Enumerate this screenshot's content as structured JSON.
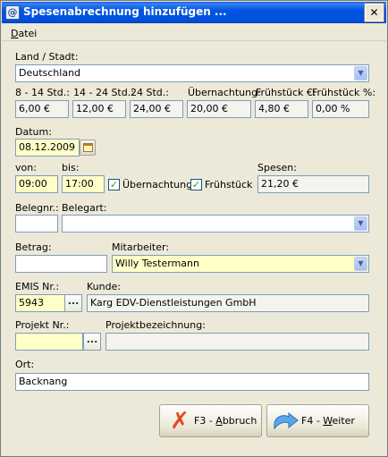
{
  "window": {
    "title": "Spesenabrechnung hinzufügen ...",
    "close_glyph": "✕",
    "app_icon": "@"
  },
  "menu": {
    "datei_underlined": "D",
    "datei_rest": "atei"
  },
  "land": {
    "label": "Land / Stadt:",
    "value": "Deutschland"
  },
  "rates": [
    {
      "label": "8 - 14 Std.:",
      "value": "6,00 €"
    },
    {
      "label": "14 - 24 Std.:",
      "value": "12,00 €"
    },
    {
      "label": "24 Std.:",
      "value": "24,00 €"
    },
    {
      "label": "Übernachtung:",
      "value": "20,00 €"
    },
    {
      "label": "Frühstück €:",
      "value": "4,80 €"
    },
    {
      "label": "Frühstück %:",
      "value": "0,00 %"
    }
  ],
  "datum": {
    "label": "Datum:",
    "value": "08.12.2009"
  },
  "von": {
    "label": "von:",
    "value": "09:00"
  },
  "bis": {
    "label": "bis:",
    "value": "17:00"
  },
  "uebernachtung": {
    "label": "Übernachtung",
    "checked": true,
    "check_glyph": "✓"
  },
  "fruehstueck": {
    "label": "Frühstück",
    "checked": true,
    "check_glyph": "✓"
  },
  "spesen": {
    "label": "Spesen:",
    "value": "21,20 €"
  },
  "belegnr": {
    "label": "Belegnr.:",
    "value": ""
  },
  "belegart": {
    "label": "Belegart:",
    "value": ""
  },
  "betrag": {
    "label": "Betrag:",
    "value": ""
  },
  "mitarbeiter": {
    "label": "Mitarbeiter:",
    "value": "Willy Testermann"
  },
  "emis": {
    "label": "EMIS Nr.:",
    "value": "5943",
    "button": "..."
  },
  "kunde": {
    "label": "Kunde:",
    "value": "Karg EDV-Dienstleistungen GmbH"
  },
  "projekt": {
    "label": "Projekt Nr.:",
    "value": "",
    "button": "..."
  },
  "projektbez": {
    "label": "Projektbezeichnung:",
    "value": ""
  },
  "ort": {
    "label": "Ort:",
    "value": "Backnang"
  },
  "buttons": {
    "abbruch": {
      "pre": "F3 - ",
      "underlined": "A",
      "post": "bbruch",
      "icon_glyph": "✗"
    },
    "weiter": {
      "pre": "F4 - ",
      "underlined": "W",
      "post": "eiter"
    }
  },
  "colors": {
    "title_bar": "#0054e3",
    "required_field": "#ffffc8",
    "field_border": "#7f9db9"
  },
  "icons": {
    "combo_arrow": "▼"
  }
}
